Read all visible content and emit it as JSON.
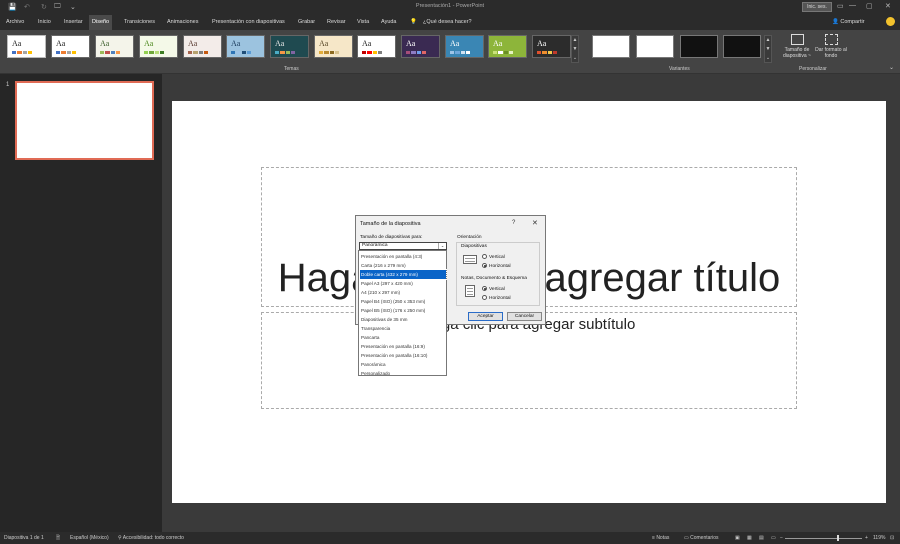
{
  "titlebar": {
    "title": "Presentación1  -  PowerPoint",
    "signin": "Inic. ses.",
    "qa_save": "💾",
    "qa_undo": "↶",
    "qa_redo": "↻",
    "qa_slideshow": "🖵",
    "qa_more": "⌄",
    "min": "—",
    "restore": "▢",
    "close": "✕"
  },
  "tabs": [
    {
      "label": "Archivo"
    },
    {
      "label": "Inicio"
    },
    {
      "label": "Insertar"
    },
    {
      "label": "Diseño"
    },
    {
      "label": "Transiciones"
    },
    {
      "label": "Animaciones"
    },
    {
      "label": "Presentación con diapositivas"
    },
    {
      "label": "Grabar"
    },
    {
      "label": "Revisar"
    },
    {
      "label": "Vista"
    },
    {
      "label": "Ayuda"
    },
    {
      "label": "¿Qué desea hacer?"
    }
  ],
  "share": "Compartir",
  "ribbon": {
    "themes_group": "Temas",
    "variants_group": "Variantes",
    "customize_group": "Personalizar",
    "theme_sample": "Aa",
    "slide_size_btn": "Tamaño de diapositiva ~",
    "format_bg_btn": "Dar formato al fondo",
    "themes": [
      {
        "bg": "#ffffff",
        "fg": "#222222",
        "bars": [
          "#4472c4",
          "#ed7d31",
          "#a5a5a5",
          "#ffc000"
        ]
      },
      {
        "bg": "#ffffff",
        "fg": "#222222",
        "bars": [
          "#4472c4",
          "#ed7d31",
          "#a5a5a5",
          "#ffc000"
        ]
      },
      {
        "bg": "#f4f4ea",
        "fg": "#3b5e2b",
        "bars": [
          "#9bbb59",
          "#c0504d",
          "#4f81bd",
          "#f79646"
        ]
      },
      {
        "bg": "#f4f9e8",
        "fg": "#4e8a20",
        "bars": [
          "#92d050",
          "#6fa83a",
          "#b7de78",
          "#3c7d22"
        ]
      },
      {
        "bg": "#f3ece9",
        "fg": "#5a3b32",
        "bars": [
          "#a5644e",
          "#b7a26e",
          "#7e7e7e",
          "#c55a11"
        ]
      },
      {
        "bg": "#9cc3df",
        "fg": "#1a3b5c",
        "bars": [
          "#2e75b6",
          "#9dc3e6",
          "#1f4e79",
          "#5b9bd5"
        ]
      },
      {
        "bg": "#1f4a50",
        "fg": "#e7e7e7",
        "bars": [
          "#4bacc6",
          "#f79646",
          "#9bbb59",
          "#8064a2"
        ]
      },
      {
        "bg": "#f6e7c8",
        "fg": "#5a4a2a",
        "bars": [
          "#e2ac39",
          "#b9892e",
          "#8c6a1f",
          "#d9c28d"
        ]
      },
      {
        "bg": "#ffffff",
        "fg": "#222222",
        "bars": [
          "#c00000",
          "#ff0000",
          "#ffc000",
          "#7f7f7f"
        ]
      },
      {
        "bg": "#3a2a52",
        "fg": "#ffffff",
        "bars": [
          "#a64d79",
          "#8e7cc3",
          "#6d9eeb",
          "#e06666"
        ]
      },
      {
        "bg": "#3a86b4",
        "fg": "#ffffff",
        "bars": [
          "#9fc5e8",
          "#6fa8dc",
          "#cfe2f3",
          "#ffffff"
        ]
      },
      {
        "bg": "#8db53a",
        "fg": "#ffffff",
        "bars": [
          "#c9e27a",
          "#ffffff",
          "#6a8f25",
          "#e4f1c0"
        ]
      },
      {
        "bg": "#2c2c2c",
        "fg": "#ffffff",
        "bars": [
          "#e0502d",
          "#f08e2e",
          "#f2c94c",
          "#c0392b"
        ]
      }
    ],
    "variants": [
      {
        "bg": "#ffffff"
      },
      {
        "bg": "#ffffff"
      },
      {
        "bg": "#111111"
      },
      {
        "bg": "#111111"
      }
    ]
  },
  "thumbnail": {
    "number": "1"
  },
  "slide": {
    "title": "Haga clic para agregar título",
    "subtitle": "Haga clic para agregar subtítulo"
  },
  "dialog": {
    "title": "Tamaño de la diapositiva",
    "help": "?",
    "close": "✕",
    "size_label": "Tamaño de diapositivas para:",
    "size_value": "Panorámica",
    "orientation_label": "Orientación",
    "slides_label": "Diapositivas",
    "notes_label": "Notas, Documento & Esquema",
    "vertical": "Vertical",
    "horizontal": "Horizontal",
    "slides_orientation": "Horizontal",
    "notes_orientation": "Vertical",
    "ok": "Aceptar",
    "cancel": "Cancelar"
  },
  "dropdown": {
    "selected": "Doble carta (432 x 279 mm)",
    "options": [
      "Presentación en pantalla (4:3)",
      "Carta (216 x 279 mm)",
      "Doble carta (432 x 279 mm)",
      "Papel A3 (297 x 420 mm)",
      "A4 (210 x 297 mm)",
      "Papel B4 (ISO) (250 x 353 mm)",
      "Papel B5 (ISO) (176 x 250 mm)",
      "Diapositivas de 35 mm",
      "Transparencia",
      "Pancarta",
      "Presentación en pantalla (16:9)",
      "Presentación en pantalla (16:10)",
      "Panorámica",
      "Personalizado"
    ]
  },
  "status": {
    "slide_count": "Diapositiva 1 de 1",
    "language": "Español (México)",
    "accessibility": "Accesibilidad: todo correcto",
    "notes": "Notas",
    "comments": "Comentarios",
    "zoom": "119%",
    "zoom_out": "−",
    "zoom_in": "+"
  }
}
